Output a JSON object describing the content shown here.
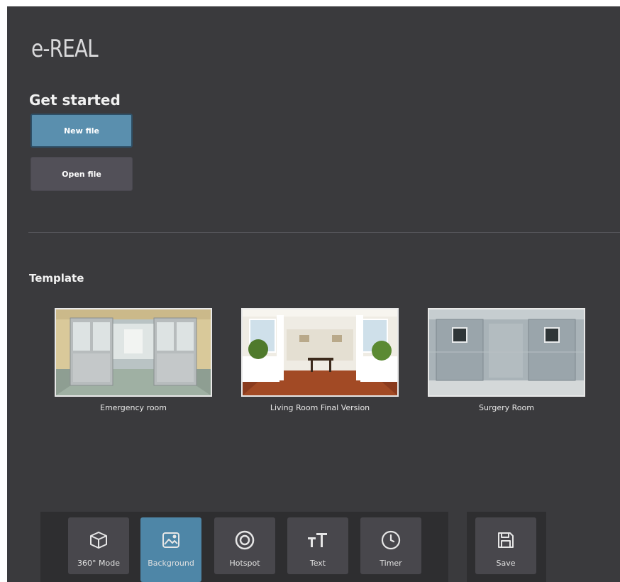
{
  "app": {
    "logo": "e-REAL"
  },
  "get_started": {
    "heading": "Get started",
    "new_file_label": "New file",
    "open_file_label": "Open file"
  },
  "templates": {
    "heading": "Template",
    "items": [
      {
        "name": "Emergency room"
      },
      {
        "name": "Living Room Final Version"
      },
      {
        "name": "Surgery Room"
      }
    ]
  },
  "toolbar": {
    "tools": [
      {
        "label": "360° Mode",
        "icon": "cube-icon",
        "active": false
      },
      {
        "label": "Background",
        "icon": "image-icon",
        "active": true
      },
      {
        "label": "Hotspot",
        "icon": "target-icon",
        "active": false
      },
      {
        "label": "Text",
        "icon": "text-icon",
        "active": false
      },
      {
        "label": "Timer",
        "icon": "clock-icon",
        "active": false
      }
    ],
    "save_label": "Save"
  },
  "colors": {
    "background": "#3a3a3d",
    "primary_button": "#5a8fae",
    "active_tool": "#4e86a7",
    "toolbar": "#2e2e30"
  }
}
